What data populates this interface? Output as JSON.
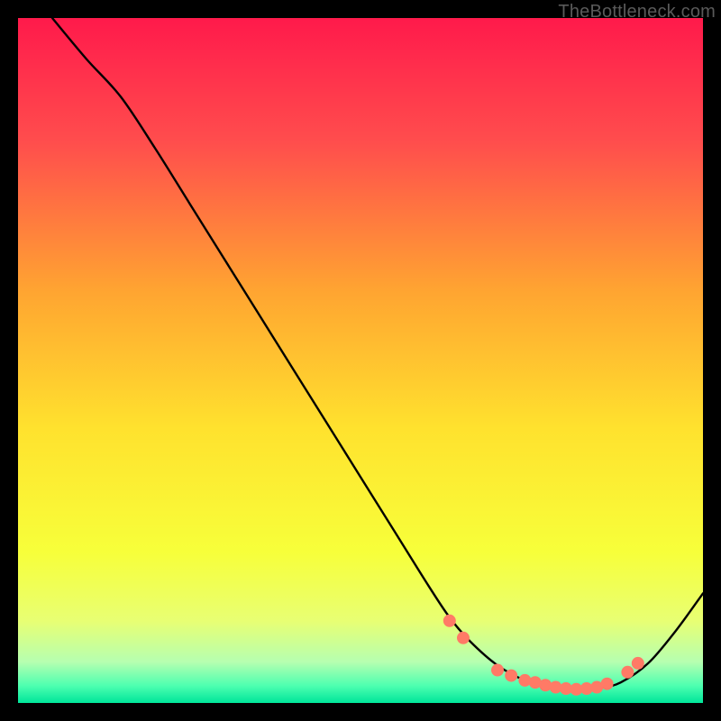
{
  "attribution": "TheBottleneck.com",
  "chart_data": {
    "type": "line",
    "title": "",
    "xlabel": "",
    "ylabel": "",
    "xlim": [
      0,
      100
    ],
    "ylim": [
      0,
      100
    ],
    "background_gradient": {
      "stops": [
        {
          "offset": 0.0,
          "color": "#ff1a4b"
        },
        {
          "offset": 0.18,
          "color": "#ff4d4d"
        },
        {
          "offset": 0.4,
          "color": "#ffa531"
        },
        {
          "offset": 0.6,
          "color": "#ffe22e"
        },
        {
          "offset": 0.78,
          "color": "#f7ff3a"
        },
        {
          "offset": 0.88,
          "color": "#e8ff73"
        },
        {
          "offset": 0.94,
          "color": "#b6ffb0"
        },
        {
          "offset": 0.975,
          "color": "#4dffb0"
        },
        {
          "offset": 1.0,
          "color": "#00e59a"
        }
      ]
    },
    "series": [
      {
        "name": "curve",
        "x": [
          5,
          10,
          15,
          20,
          25,
          30,
          35,
          40,
          45,
          50,
          55,
          60,
          63,
          66,
          70,
          74,
          78,
          82,
          85,
          88,
          92,
          96,
          100
        ],
        "y": [
          100,
          94,
          88.5,
          81,
          73,
          65,
          57,
          49,
          41,
          33,
          25,
          17,
          12.5,
          9,
          5.5,
          3.3,
          2.2,
          2.0,
          2.2,
          3.0,
          5.8,
          10.5,
          16
        ],
        "stroke": "#000000",
        "stroke_width": 2.4
      }
    ],
    "markers": {
      "name": "dots",
      "color": "#ff7a66",
      "radius": 7,
      "points": [
        {
          "x": 63,
          "y": 12.0
        },
        {
          "x": 65,
          "y": 9.5
        },
        {
          "x": 70,
          "y": 4.8
        },
        {
          "x": 72,
          "y": 4.0
        },
        {
          "x": 74,
          "y": 3.3
        },
        {
          "x": 75.5,
          "y": 3.0
        },
        {
          "x": 77,
          "y": 2.6
        },
        {
          "x": 78.5,
          "y": 2.3
        },
        {
          "x": 80,
          "y": 2.1
        },
        {
          "x": 81.5,
          "y": 2.0
        },
        {
          "x": 83,
          "y": 2.1
        },
        {
          "x": 84.5,
          "y": 2.3
        },
        {
          "x": 86,
          "y": 2.8
        },
        {
          "x": 89,
          "y": 4.5
        },
        {
          "x": 90.5,
          "y": 5.8
        }
      ]
    }
  }
}
